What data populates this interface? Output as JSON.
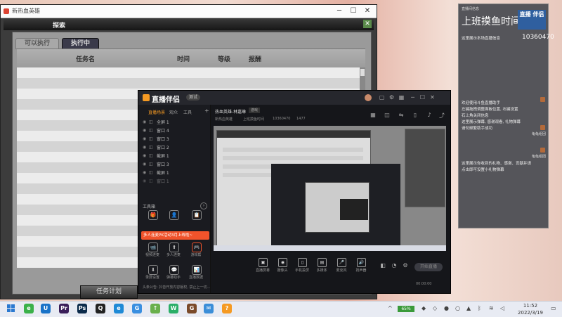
{
  "game_window": {
    "title": "新热血英雄",
    "header_label": "探索",
    "close_glyph": "✕",
    "tabs": [
      {
        "label": "可以执行"
      },
      {
        "label": "执行中"
      }
    ],
    "columns": [
      "任务名",
      "时间",
      "等级",
      "报酬"
    ],
    "action_button": "任务计划"
  },
  "stream_app": {
    "brand": "直播伴侣",
    "brand_pill": "测试",
    "side_tabs": [
      "直播场景",
      "观众",
      "工具"
    ],
    "scenes": [
      "全屏 1",
      "窗口 4",
      "窗口 3",
      "窗口 2",
      "截屏 1",
      "窗口 3",
      "截屏 1",
      "窗口 1"
    ],
    "tools_header": "工具箱",
    "tools": [
      {
        "label": "",
        "icon": "🎁"
      },
      {
        "label": "",
        "icon": "👤"
      },
      {
        "label": "",
        "icon": "📋"
      },
      {
        "label": "视频连麦",
        "icon": "📹"
      },
      {
        "label": "多人连麦",
        "icon": "⬆"
      },
      {
        "label": "游戏帮",
        "icon": "🎮"
      },
      {
        "label": "录屏设置",
        "icon": "⬇"
      },
      {
        "label": "弹幕助手",
        "icon": "💬"
      },
      {
        "label": "直播数据",
        "icon": "📊"
      }
    ],
    "promo_text": "多人连麦PK活动3月上线啦~",
    "main_title": "热血英雄-林嘉琳",
    "main_tag": "游戏",
    "sub_info": [
      "新热血英雄",
      "上班摸鱼时间",
      "10360470",
      "1477"
    ],
    "controls": [
      {
        "label": "直播屏幕",
        "icon": "▣"
      },
      {
        "label": "摄像头",
        "icon": "◉"
      },
      {
        "label": "手机投屏",
        "icon": "▯"
      },
      {
        "label": "多媒体",
        "icon": "▤"
      },
      {
        "label": "麦克风",
        "icon": "🎤"
      },
      {
        "label": "扬声器",
        "icon": "🔊"
      }
    ],
    "start_button": "开始直播",
    "footer_left": "头条公告: 抖音开放内容版权, 禁止上一切...",
    "footer_right": "00:00:00"
  },
  "chat_panel": {
    "header": "直播间信息",
    "title": "上班摸鱼时间",
    "logo_text": "直播 伴侣",
    "note1": "这里展示本场直播信息",
    "room_number": "10360470",
    "welcome_lines": [
      "欢迎使用斗鱼直播助手",
      "左键拖拽调整面板位置, 右键设置",
      "石上角关闭信息",
      "这里展示弹幕, 感谢观看, 礼物弹幕",
      "请勿频繁助手成功"
    ],
    "gift_note": "这里展示你收到的礼物、感谢、贡献并请",
    "gift_note2": "点击即可设置小礼物弹幕",
    "gift_labels": [
      "龟龟组团",
      "龟龟组团"
    ]
  },
  "taskbar": {
    "battery": "65%",
    "time": "11:52",
    "date": "2022/3/19"
  }
}
